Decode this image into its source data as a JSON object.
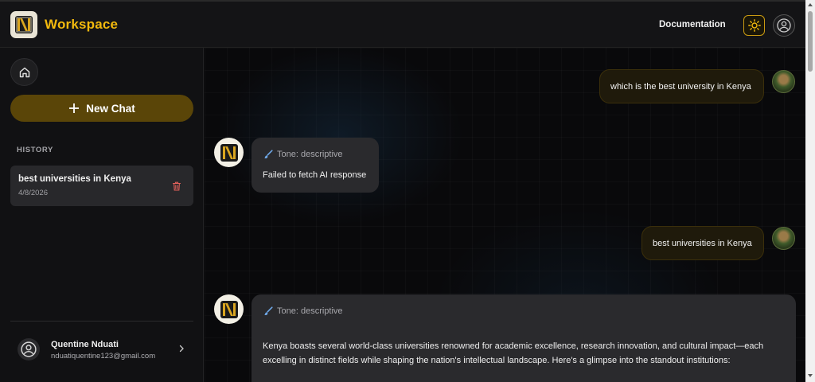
{
  "header": {
    "brand": "Workspace",
    "documentation_label": "Documentation",
    "icons": {
      "logo": "n-monogram-logo",
      "theme": "sun-icon",
      "user": "user-circle-icon"
    }
  },
  "sidebar": {
    "new_chat_label": "New Chat",
    "history_label": "HISTORY",
    "history": [
      {
        "title": "best universities in Kenya",
        "date": "4/8/2026"
      }
    ],
    "profile": {
      "name": "Quentine Nduati",
      "email": "nduatiquentine123@gmail.com"
    }
  },
  "chat": {
    "messages": [
      {
        "role": "user",
        "text": "which is the best university in Kenya"
      },
      {
        "role": "assistant",
        "tone": "Tone: descriptive",
        "text": "Failed to fetch AI response"
      },
      {
        "role": "user",
        "text": "best universities in Kenya"
      },
      {
        "role": "assistant",
        "tone": "Tone: descriptive",
        "text_line1": "Kenya boasts several world-class universities renowned for academic excellence, research innovation, and cultural impact—each",
        "text_line2": "excelling in distinct fields while shaping the nation's intellectual landscape. Here's a glimpse into the standout institutions:"
      }
    ]
  },
  "colors": {
    "accent": "#f2b90d",
    "new_chat_bg": "#5a4508",
    "bubble_bg": "#2a2a2d"
  }
}
